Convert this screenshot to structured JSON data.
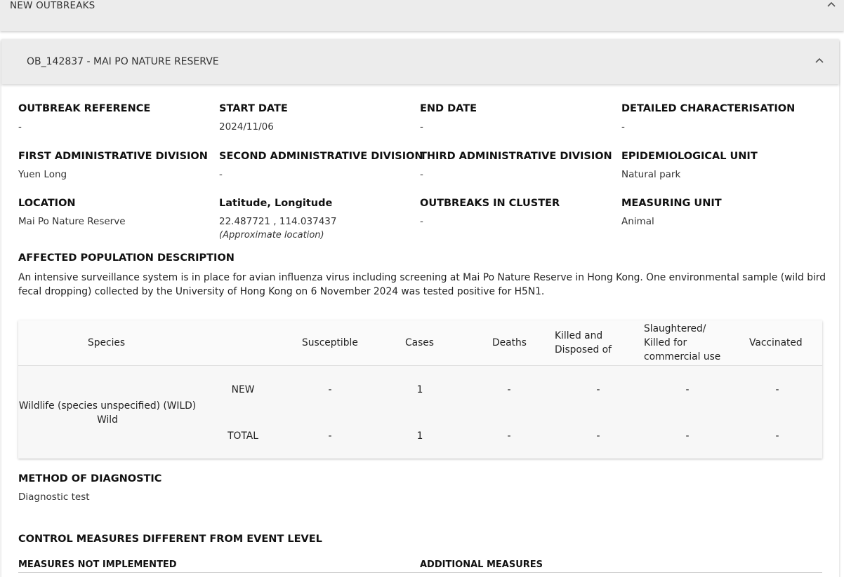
{
  "top_panel": {
    "title": "NEW OUTBREAKS"
  },
  "outbreak": {
    "title": "OB_142837 - MAI PO NATURE RESERVE",
    "fields": {
      "outbreak_reference": {
        "label": "OUTBREAK REFERENCE",
        "value": "-"
      },
      "start_date": {
        "label": "START DATE",
        "value": "2024/11/06"
      },
      "end_date": {
        "label": "END DATE",
        "value": "-"
      },
      "detailed_characterisation": {
        "label": "DETAILED CHARACTERISATION",
        "value": "-"
      },
      "first_admin": {
        "label": "FIRST ADMINISTRATIVE DIVISION",
        "value": "Yuen Long"
      },
      "second_admin": {
        "label": "SECOND ADMINISTRATIVE DIVISION",
        "value": "-"
      },
      "third_admin": {
        "label": "THIRD ADMINISTRATIVE DIVISION",
        "value": "-"
      },
      "epi_unit": {
        "label": "EPIDEMIOLOGICAL UNIT",
        "value": "Natural park"
      },
      "location": {
        "label": "LOCATION",
        "value": "Mai Po Nature Reserve"
      },
      "lat_long": {
        "label": "Latitude, Longitude",
        "value": "22.487721 , 114.037437",
        "note": "(Approximate location)"
      },
      "outbreaks_in_cluster": {
        "label": "OUTBREAKS IN CLUSTER",
        "value": "-"
      },
      "measuring_unit": {
        "label": "MEASURING UNIT",
        "value": "Animal"
      }
    },
    "affected_population": {
      "label": "AFFECTED POPULATION DESCRIPTION",
      "text": "An intensive surveillance system is in place for avian influenza virus including screening at Mai Po Nature Reserve in Hong Kong. One environmental sample (wild bird fecal dropping) collected by the University of Hong Kong on 6 November 2024 was tested positive for H5N1."
    },
    "table": {
      "headers": {
        "species": "Species",
        "susceptible": "Susceptible",
        "cases": "Cases",
        "deaths": "Deaths",
        "killed_line1": "Killed and",
        "killed_line2": "Disposed of",
        "slaughtered_line1": "Slaughtered/",
        "slaughtered_line2": "Killed for",
        "slaughtered_line3": "commercial use",
        "vaccinated": "Vaccinated"
      },
      "species_name": "Wildlife (species unspecified) (WILD)",
      "species_type": "Wild",
      "rows": [
        {
          "label": "NEW",
          "susceptible": "-",
          "cases": "1",
          "deaths": "-",
          "killed": "-",
          "slaughtered": "-",
          "vaccinated": "-"
        },
        {
          "label": "TOTAL",
          "susceptible": "-",
          "cases": "1",
          "deaths": "-",
          "killed": "-",
          "slaughtered": "-",
          "vaccinated": "-"
        }
      ]
    },
    "diagnostic": {
      "label": "METHOD OF DIAGNOSTIC",
      "value": "Diagnostic test"
    },
    "control_measures": {
      "label": "CONTROL MEASURES DIFFERENT FROM EVENT LEVEL",
      "not_implemented": "MEASURES NOT IMPLEMENTED",
      "additional": "ADDITIONAL MEASURES"
    }
  },
  "icons": {
    "collapse": "chevron-up-icon"
  }
}
